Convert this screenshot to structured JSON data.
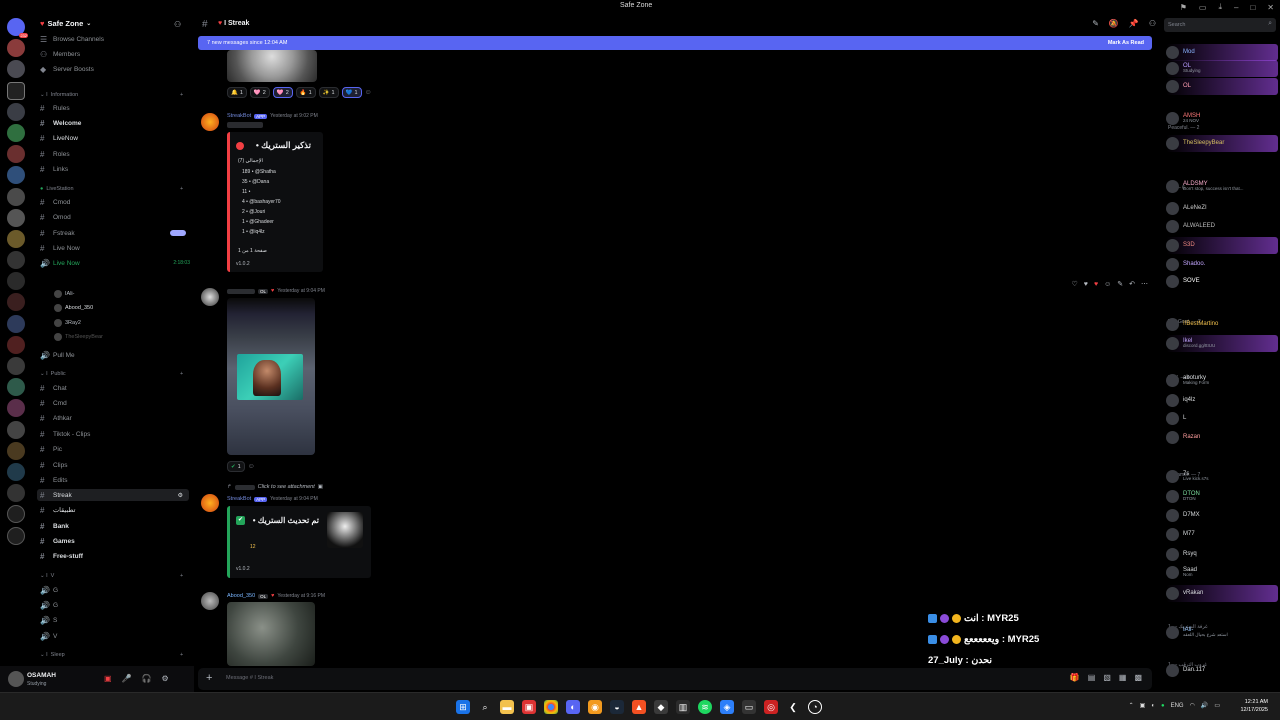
{
  "window": {
    "title": "Safe Zone"
  },
  "server": {
    "name": "Safe Zone"
  },
  "rail": {
    "badges": [
      "232",
      "",
      "",
      "",
      "",
      "",
      "",
      "",
      "",
      "",
      "",
      "",
      "",
      "",
      "",
      "",
      "",
      "",
      "",
      "",
      "",
      "",
      "",
      "",
      "",
      "",
      "",
      "",
      "",
      ""
    ]
  },
  "nav": {
    "browse": "Browse Channels",
    "members": "Members",
    "boosts": "Server Boosts"
  },
  "categories": {
    "information": "Information",
    "livestation": "LiveStation",
    "public": "Public",
    "v": "V",
    "sleep": "Sleep"
  },
  "channels": {
    "rules": "Rules",
    "welcome": "Welcome",
    "livenow1": "LiveNow",
    "roles": "Roles",
    "links": "Links",
    "cmod": "Cmod",
    "omod": "Omod",
    "fstreak": "Fstreak",
    "livenow2": "Live Now",
    "livenow_voice": "Live Now",
    "livenow_time": "2:18:03",
    "pull": "Pull Me",
    "chat": "Chat",
    "cmd": "Cmd",
    "athkar": "Athkar",
    "tiktok": "Tiktok - Clips",
    "pic": "Pic",
    "clips": "Clips",
    "edits": "Edits",
    "streak": "Streak",
    "arabic": "تطبيقات",
    "bank": "Bank",
    "games": "Games",
    "free": "Free-stuff",
    "g1": "G",
    "g2": "G",
    "s": "S",
    "v": "V"
  },
  "voice_users": [
    "IAli-",
    "Abood_350",
    "3Ray2",
    "TheSleepyBear"
  ],
  "user": {
    "name": "OSAMAH",
    "status": "Studying"
  },
  "chat": {
    "channel": "Streak",
    "new_messages": "7 new messages since 12:04 AM",
    "mark_read": "Mark As Read",
    "reactions": [
      {
        "icon": "🔔",
        "count": "1"
      },
      {
        "icon": "🩷",
        "count": "2"
      },
      {
        "icon": "🩷",
        "count": "2"
      },
      {
        "icon": "🔥",
        "count": "1"
      },
      {
        "icon": "✨",
        "count": "1"
      },
      {
        "icon": "💙",
        "count": "1"
      }
    ],
    "msg1": {
      "author": "StreakBot",
      "tag": "APP",
      "time": "Yesterday at 9:02 PM",
      "embed_title": "تذكير الستريك •",
      "subtitle": "(7) الإجمالي",
      "lines": [
        "189 • @Shatha",
        "35 • @Dana",
        "11 •",
        "4 • @bashayer70",
        "2 • @Jouri",
        "1 • @Ghadeer",
        "1 • @iq4lz"
      ],
      "footer": "صفحة 1 من 1",
      "version": "v1.0.2"
    },
    "msg2": {
      "author": "",
      "time": "Yesterday at 9:04 PM",
      "reaction_count": "1"
    },
    "msg3": {
      "reply": "Click to see attachment",
      "author": "StreakBot",
      "tag": "APP",
      "time": "Yesterday at 9:04 PM",
      "embed_title": "تم تحديث الستريك •",
      "value": "12",
      "version": "v1.0.2"
    },
    "msg4": {
      "author": "Abood_350",
      "tag": "OL",
      "time": "Yesterday at 9:16 PM"
    },
    "composer_placeholder": "Message # I Streak"
  },
  "overlay": [
    {
      "text": "انت : MYR25"
    },
    {
      "text": "ويعععععع : MYR25"
    },
    {
      "text": "27_July : نحدن"
    }
  ],
  "members": {
    "search_placeholder": "Search",
    "groups": [
      "Peaceful. — 2",
      "C1 — 6",
      "The Goat. — 2",
      "Mod. — 4",
      "Streamer. — 7",
      "غرفة الستريك — 1",
      "غروب الترقب — 1"
    ],
    "list": [
      {
        "name": "Mod",
        "sub": ""
      },
      {
        "name": "OL",
        "sub": "Studying"
      },
      {
        "name": "OL",
        "sub": ""
      },
      {
        "name": "AMSH",
        "sub": "24 NOV"
      },
      {
        "name": "TheSleepyBear",
        "sub": ""
      },
      {
        "name": "ALDSMY",
        "sub": "Don't stop, success isn't that..."
      },
      {
        "name": "ALeNeZI",
        "sub": ""
      },
      {
        "name": "ALWALEED",
        "sub": ""
      },
      {
        "name": "S3D",
        "sub": ""
      },
      {
        "name": "Shadoo.",
        "sub": ""
      },
      {
        "name": "SOVE",
        "sub": ""
      },
      {
        "name": "!!BestMartino",
        "sub": ""
      },
      {
        "name": "Ikel",
        "sub": "discord.gg/ttIUU"
      },
      {
        "name": "aboturky",
        "sub": "Making Form"
      },
      {
        "name": "iq4lz",
        "sub": ""
      },
      {
        "name": "L",
        "sub": ""
      },
      {
        "name": "Razan",
        "sub": ""
      },
      {
        "name": "7s",
        "sub": "Live kick.s7s"
      },
      {
        "name": "DTON",
        "sub": "DTON"
      },
      {
        "name": "D7MX",
        "sub": ""
      },
      {
        "name": "M77",
        "sub": ""
      },
      {
        "name": "Rsyq",
        "sub": ""
      },
      {
        "name": "Saad",
        "sub": "Nom"
      },
      {
        "name": "vRakan",
        "sub": ""
      },
      {
        "name": "IAli-",
        "sub": "استعد شرع بحيال اللعقه"
      },
      {
        "name": "Dan.117",
        "sub": ""
      }
    ]
  },
  "taskbar": {
    "lang": "ENG",
    "time": "12:21 AM",
    "date": "12/17/2025"
  },
  "colors": {
    "accent": "#5865f2",
    "danger": "#f23f43",
    "success": "#23a55a"
  }
}
